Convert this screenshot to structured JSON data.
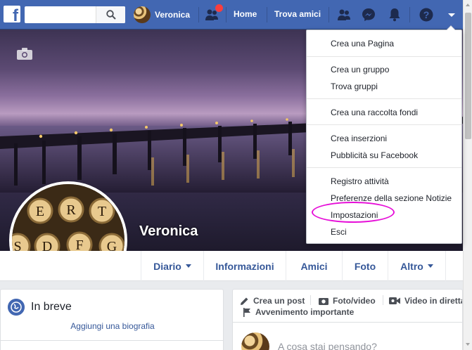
{
  "colors": {
    "brand": "#4267b2",
    "link": "#365899",
    "highlight": "#e60fd8",
    "notification": "#fa3e3e"
  },
  "header": {
    "logo": "f",
    "search_placeholder": "",
    "profile_name": "Veronica",
    "home_label": "Home",
    "find_friends_label": "Trova amici",
    "icons": [
      "facebook-logo",
      "search-icon",
      "friend-requests-icon",
      "messenger-icon",
      "notifications-icon",
      "help-icon",
      "account-menu-arrow-icon"
    ]
  },
  "cover": {
    "camera_icon": "camera-icon",
    "profile_name": "Veronica"
  },
  "tabs": [
    {
      "label": "Diario",
      "has_caret": true
    },
    {
      "label": "Informazioni",
      "has_caret": false
    },
    {
      "label": "Amici",
      "has_caret": false
    },
    {
      "label": "Foto",
      "has_caret": false
    },
    {
      "label": "Altro",
      "has_caret": true
    }
  ],
  "intro_card": {
    "title": "In breve",
    "add_bio": "Aggiungi una biografia"
  },
  "composer": {
    "create_post": "Crea un post",
    "photo_video": "Foto/video",
    "live_video": "Video in diretta",
    "life_event": "Avvenimento importante",
    "placeholder": "A cosa stai pensando?"
  },
  "dropdown": {
    "groups": [
      [
        "Crea una Pagina"
      ],
      [
        "Crea un gruppo",
        "Trova gruppi"
      ],
      [
        "Crea una raccolta fondi"
      ],
      [
        "Crea inserzioni",
        "Pubblicità su Facebook"
      ],
      [
        "Registro attività",
        "Preferenze della sezione Notizie",
        "Impostazioni",
        "Esci"
      ]
    ],
    "highlighted_item": "Impostazioni"
  }
}
